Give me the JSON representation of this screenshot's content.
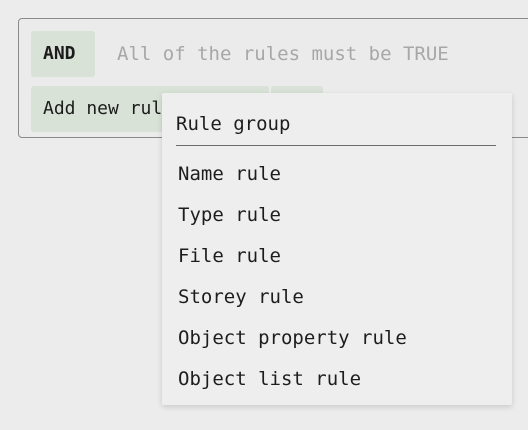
{
  "rule_group": {
    "operator_label": "AND",
    "operator_description": "All of the rules must be TRUE",
    "add_button_label": "Add new rule"
  },
  "menu": {
    "header": "Rule group",
    "items": [
      "Name rule",
      "Type rule",
      "File rule",
      "Storey rule",
      "Object property rule",
      "Object list rule"
    ]
  }
}
